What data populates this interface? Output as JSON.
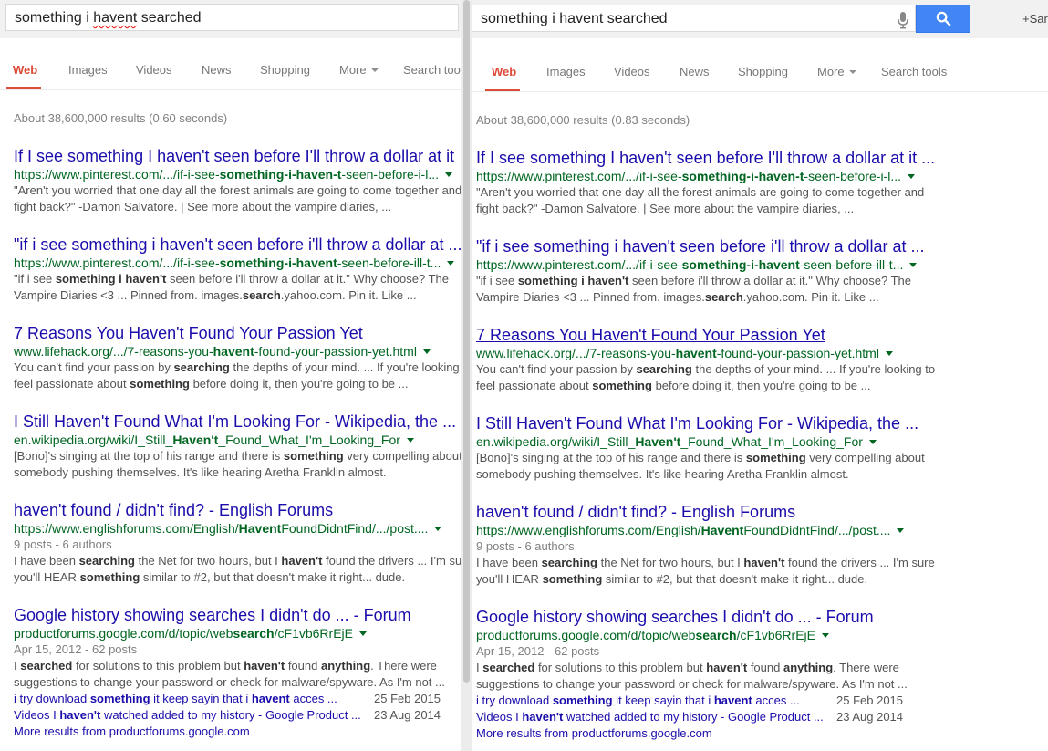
{
  "query_text": "something i havent searched",
  "query_parts": [
    "something i ",
    "havent",
    " searched"
  ],
  "signin": "+Sar",
  "tabs": [
    {
      "label": "Web",
      "active": true
    },
    {
      "label": "Images"
    },
    {
      "label": "Videos"
    },
    {
      "label": "News"
    },
    {
      "label": "Shopping"
    },
    {
      "label": "More",
      "caret": true
    },
    {
      "label": "Search tools"
    }
  ],
  "stats_left": "About 38,600,000 results (0.60 seconds)",
  "stats_right": "About 38,600,000 results (0.83 seconds)",
  "results": [
    {
      "title_left": "If I see something I haven't seen before I'll throw a dollar at it",
      "title_right": "If I see something I haven't seen before I'll throw a dollar at it ...",
      "url_parts": [
        [
          "https://www.pinterest.com/.../if-i-see-",
          false
        ],
        [
          "something-i-haven-t",
          true
        ],
        [
          "-seen-before-i-l...",
          false
        ]
      ],
      "snippet": [
        [
          [
            "\"Aren't you worried that one day all the forest animals are going to come together and",
            false
          ]
        ],
        [
          [
            "fight back?\" -Damon Salvatore. | See more about the vampire diaries, ...",
            false
          ]
        ]
      ]
    },
    {
      "title_left": "\"if i see something i haven't seen before i'll throw a dollar at ...",
      "title_right": "\"if i see something i haven't seen before i'll throw a dollar at ...",
      "url_parts": [
        [
          "https://www.pinterest.com/.../if-i-see-",
          false
        ],
        [
          "something-i-havent",
          true
        ],
        [
          "-seen-before-ill-t...",
          false
        ]
      ],
      "snippet": [
        [
          [
            "\"if i see ",
            false
          ],
          [
            "something i haven't",
            true
          ],
          [
            " seen before i'll throw a dollar at it.\" Why choose? The",
            false
          ]
        ],
        [
          [
            "Vampire Diaries <3 ... Pinned from. images.",
            false
          ],
          [
            "search",
            true
          ],
          [
            ".yahoo.com. Pin it. Like ...",
            false
          ]
        ]
      ]
    },
    {
      "title_left": "7 Reasons You Haven't Found Your Passion Yet",
      "title_right": "7 Reasons You Haven't Found Your Passion Yet",
      "underline_right": true,
      "url_parts": [
        [
          "www.lifehack.org/.../7-reasons-you-",
          false
        ],
        [
          "havent",
          true
        ],
        [
          "-found-your-passion-yet.html",
          false
        ]
      ],
      "snippet": [
        [
          [
            "You can't find your passion by ",
            false
          ],
          [
            "searching",
            true
          ],
          [
            " the depths of your mind. ... If you're looking to",
            false
          ]
        ],
        [
          [
            "feel passionate about ",
            false
          ],
          [
            "something",
            true
          ],
          [
            " before doing it, then you're going to be ...",
            false
          ]
        ]
      ]
    },
    {
      "title_left": "I Still Haven't Found What I'm Looking For - Wikipedia, the ...",
      "title_right": "I Still Haven't Found What I'm Looking For - Wikipedia, the ...",
      "url_parts": [
        [
          "en.wikipedia.org/wiki/I_Still_",
          false
        ],
        [
          "Haven't",
          true
        ],
        [
          "_Found_What_I'm_Looking_For",
          false
        ]
      ],
      "snippet": [
        [
          [
            "[Bono]'s singing at the top of his range and there is ",
            false
          ],
          [
            "something",
            true
          ],
          [
            " very compelling about",
            false
          ]
        ],
        [
          [
            "somebody pushing themselves. It's like hearing Aretha Franklin almost.",
            false
          ]
        ]
      ]
    },
    {
      "title_left": "haven't found / didn't find? - English Forums",
      "title_right": "haven't found / didn't find? - English Forums",
      "url_parts": [
        [
          "https://www.englishforums.com/English/",
          false
        ],
        [
          "Havent",
          true
        ],
        [
          "FoundDidntFind/.../post....",
          false
        ]
      ],
      "meta": "9 posts - 6 authors",
      "snippet": [
        [
          [
            "I have been ",
            false
          ],
          [
            "searching",
            true
          ],
          [
            " the Net for two hours, but I ",
            false
          ],
          [
            "haven't",
            true
          ],
          [
            " found the drivers ... I'm sure",
            false
          ]
        ],
        [
          [
            "you'll HEAR ",
            false
          ],
          [
            "something",
            true
          ],
          [
            " similar to #2, but that doesn't make it right... dude.",
            false
          ]
        ]
      ]
    },
    {
      "title_left": "Google history showing searches I didn't do ... - Forum",
      "title_right": "Google history showing searches I didn't do ... - Forum",
      "url_parts": [
        [
          "productforums.google.com/d/topic/web",
          false
        ],
        [
          "search",
          true
        ],
        [
          "/cF1vb6RrEjE",
          false
        ]
      ],
      "meta": "Apr 15, 2012 - 62 posts",
      "snippet": [
        [
          [
            "I ",
            false
          ],
          [
            "searched",
            true
          ],
          [
            " for solutions to this problem but ",
            false
          ],
          [
            "haven't",
            true
          ],
          [
            " found ",
            false
          ],
          [
            "anything",
            true
          ],
          [
            ". There were",
            false
          ]
        ],
        [
          [
            "suggestions to change your password or check for malware/spyware. As I'm not ...",
            false
          ]
        ]
      ],
      "sublinks": [
        {
          "parts": [
            [
              "i try download ",
              false
            ],
            [
              "something",
              true
            ],
            [
              " it keep sayin that i ",
              false
            ],
            [
              "havent",
              true
            ],
            [
              " acces ...",
              false
            ]
          ],
          "date": "25 Feb 2015"
        },
        {
          "parts": [
            [
              "Videos I ",
              false
            ],
            [
              "haven't",
              true
            ],
            [
              " watched added to my history - Google Product ...",
              false
            ]
          ],
          "date": "23 Aug 2014"
        }
      ],
      "more": "More results from productforums.google.com"
    }
  ]
}
